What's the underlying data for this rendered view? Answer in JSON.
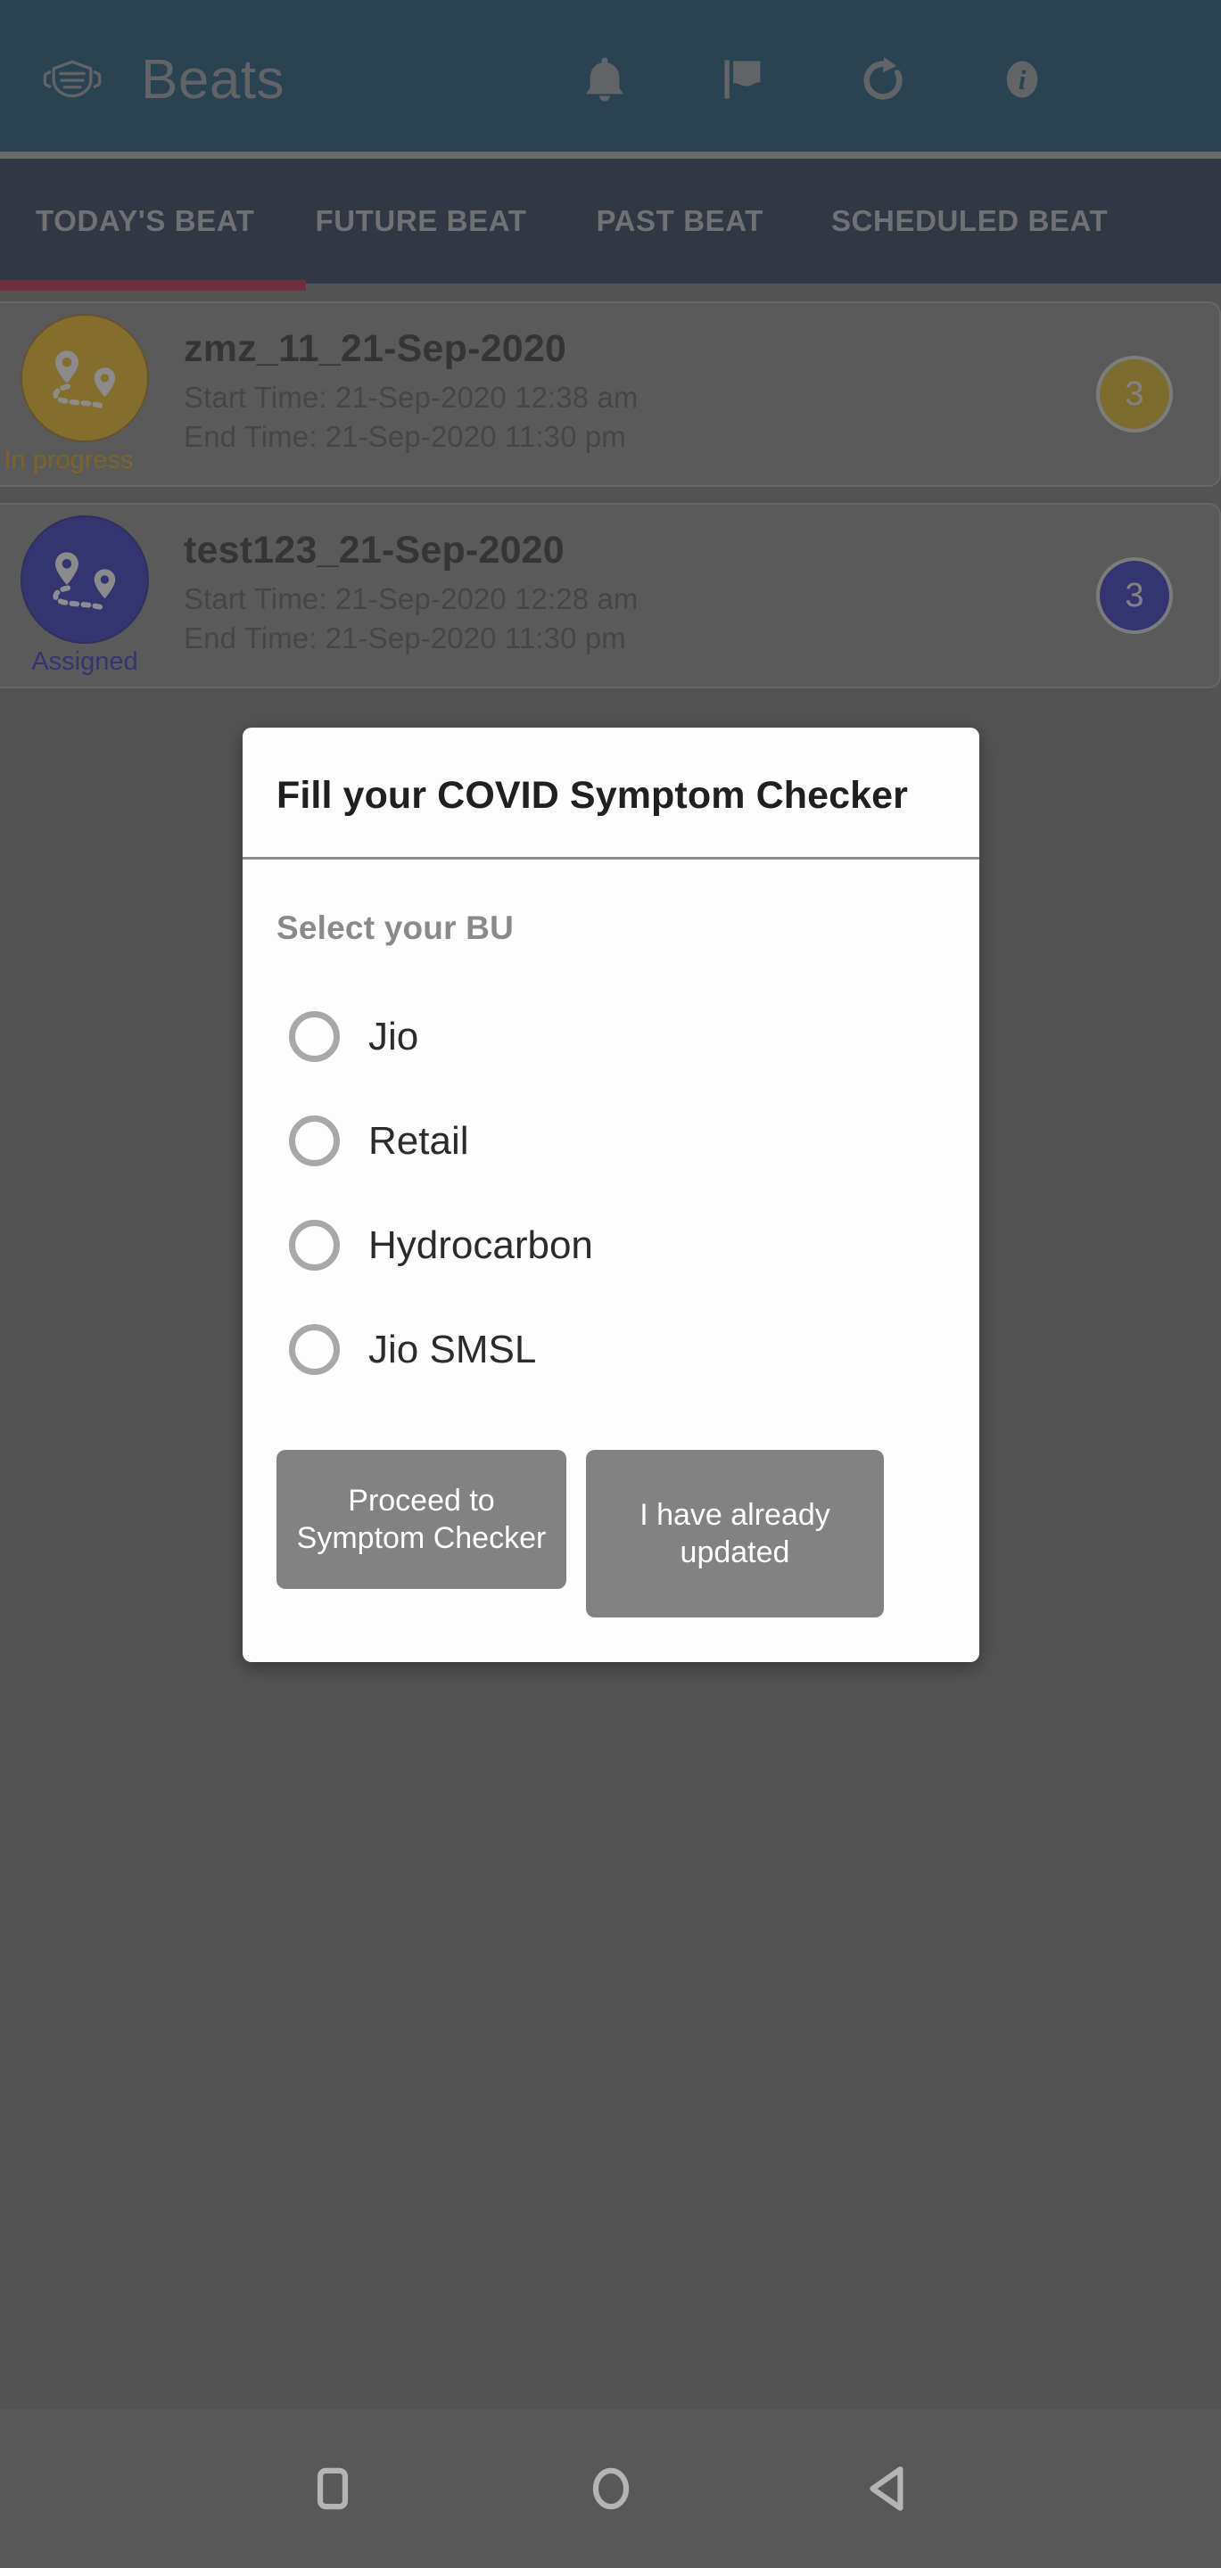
{
  "appbar": {
    "icon": "face-mask-icon",
    "title": "Beats",
    "actions": [
      {
        "name": "notifications-icon",
        "label": "Notifications"
      },
      {
        "name": "flag-icon",
        "label": "Flag"
      },
      {
        "name": "refresh-icon",
        "label": "Refresh"
      },
      {
        "name": "info-icon",
        "label": "Info"
      }
    ],
    "bg_color": "#043b5c",
    "title_color": "#7d8287"
  },
  "tabs": {
    "items": [
      {
        "label": "TODAY'S BEAT",
        "selected": true
      },
      {
        "label": "FUTURE BEAT",
        "selected": false
      },
      {
        "label": "PAST BEAT",
        "selected": false
      },
      {
        "label": "SCHEDULED BEAT",
        "selected": false
      }
    ],
    "indicator_color": "#9c0f33",
    "bg_color": "#15203d"
  },
  "beats": [
    {
      "name": "zmz_11_21-Sep-2020",
      "status": "In progress",
      "status_color": "#b8860b",
      "avatar_color": "#c9990c",
      "start_time": "Start Time: 21-Sep-2020 12:38 am",
      "end_time": "End Time:  21-Sep-2020 11:30 pm",
      "badge": "3",
      "badge_color": "#b8930d"
    },
    {
      "name": "test123_21-Sep-2020",
      "status": "Assigned",
      "status_color": "#1a1aa8",
      "avatar_color": "#1a1a9e",
      "start_time": "Start Time: 21-Sep-2020 12:28 am",
      "end_time": "End Time:  21-Sep-2020 11:30 pm",
      "badge": "3",
      "badge_color": "#1a1a9e"
    }
  ],
  "dialog": {
    "title": "Fill your COVID Symptom Checker",
    "section_label": "Select your BU",
    "options": [
      {
        "label": "Jio",
        "selected": false
      },
      {
        "label": "Retail",
        "selected": false
      },
      {
        "label": "Hydrocarbon",
        "selected": false
      },
      {
        "label": "Jio SMSL",
        "selected": false
      }
    ],
    "buttons": {
      "proceed": "Proceed to Symptom Checker",
      "already_updated": "I have already updated"
    },
    "button_color": "#828282",
    "background": "#fdfdfd"
  },
  "navbar": {
    "buttons": [
      {
        "name": "recents-button",
        "label": "Recents"
      },
      {
        "name": "home-button",
        "label": "Home"
      },
      {
        "name": "back-button",
        "label": "Back"
      }
    ],
    "bg_color": "#585858"
  }
}
